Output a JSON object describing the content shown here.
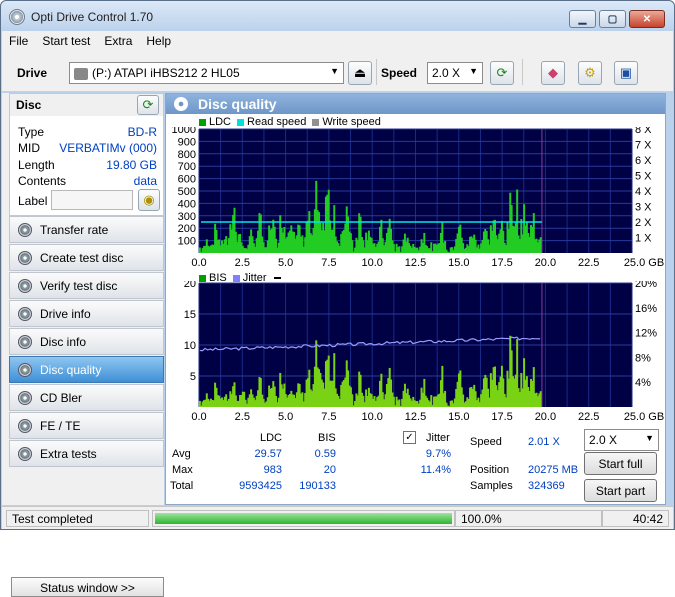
{
  "window": {
    "title": "Opti Drive Control 1.70",
    "min": "▁",
    "max": "▢",
    "close": "✕"
  },
  "menu": [
    "File",
    "Start test",
    "Extra",
    "Help"
  ],
  "toolbar": {
    "drive_label": "Drive",
    "drive_value": "(P:)   ATAPI iHBS212   2 HL05",
    "speed_label": "Speed",
    "speed_value": "2.0 X"
  },
  "disc": {
    "header": "Disc",
    "rows": [
      {
        "key": "Type",
        "value": "BD-R"
      },
      {
        "key": "MID",
        "value": "VERBATIMv (000)"
      },
      {
        "key": "Length",
        "value": "19.80 GB"
      },
      {
        "key": "Contents",
        "value": "data"
      }
    ],
    "label_key": "Label",
    "label_value": ""
  },
  "nav": [
    {
      "label": "Transfer rate",
      "active": false
    },
    {
      "label": "Create test disc",
      "active": false
    },
    {
      "label": "Verify test disc",
      "active": false
    },
    {
      "label": "Drive info",
      "active": false
    },
    {
      "label": "Disc info",
      "active": false
    },
    {
      "label": "Disc quality",
      "active": true
    },
    {
      "label": "CD Bler",
      "active": false
    },
    {
      "label": "FE / TE",
      "active": false
    },
    {
      "label": "Extra tests",
      "active": false
    }
  ],
  "status_window_btn": "Status window >>",
  "panel_title": "Disc quality",
  "chart_data": [
    {
      "type": "bar",
      "legend": [
        {
          "name": "LDC",
          "color": "#00a000"
        },
        {
          "name": "Read speed",
          "color": "#00e0e0"
        },
        {
          "name": "Write speed",
          "color": "#909090"
        }
      ],
      "xlim": [
        0,
        25
      ],
      "ylim": [
        0,
        1000
      ],
      "x_ticks": [
        "0.0",
        "2.5",
        "5.0",
        "7.5",
        "10.0",
        "12.5",
        "15.0",
        "17.5",
        "20.0",
        "22.5",
        "25.0 GB"
      ],
      "y_ticks": [
        "100",
        "200",
        "300",
        "400",
        "500",
        "600",
        "700",
        "800",
        "900",
        "1000"
      ],
      "y2_ticks": [
        "1 X",
        "2 X",
        "3 X",
        "4 X",
        "5 X",
        "6 X",
        "7 X",
        "8 X"
      ],
      "data_end_gb": 19.8,
      "read_speed_x": 2.0,
      "series_ldc_peaks": [
        [
          0.5,
          150
        ],
        [
          1.0,
          300
        ],
        [
          1.5,
          200
        ],
        [
          2.0,
          550
        ],
        [
          2.3,
          250
        ],
        [
          3.0,
          200
        ],
        [
          3.5,
          400
        ],
        [
          4.2,
          450
        ],
        [
          4.8,
          500
        ],
        [
          5.3,
          600
        ],
        [
          5.8,
          300
        ],
        [
          6.3,
          450
        ],
        [
          6.8,
          650
        ],
        [
          7.0,
          250
        ],
        [
          7.4,
          800
        ],
        [
          7.8,
          400
        ],
        [
          8.3,
          300
        ],
        [
          8.6,
          500
        ],
        [
          9.3,
          450
        ],
        [
          9.8,
          350
        ],
        [
          10.5,
          300
        ],
        [
          11.0,
          350
        ],
        [
          12.0,
          250
        ],
        [
          13.0,
          250
        ],
        [
          14.0,
          300
        ],
        [
          15.0,
          350
        ],
        [
          15.8,
          250
        ],
        [
          16.5,
          300
        ],
        [
          17.0,
          450
        ],
        [
          17.5,
          350
        ],
        [
          18.0,
          550
        ],
        [
          18.3,
          700
        ],
        [
          18.8,
          600
        ],
        [
          19.3,
          450
        ],
        [
          19.7,
          150
        ]
      ]
    },
    {
      "type": "bar",
      "legend": [
        {
          "name": "BIS",
          "color": "#00a000"
        },
        {
          "name": "Jitter",
          "color": "#8080ff"
        }
      ],
      "xlim": [
        0,
        25
      ],
      "ylim": [
        0,
        20
      ],
      "x_ticks": [
        "0.0",
        "2.5",
        "5.0",
        "7.5",
        "10.0",
        "12.5",
        "15.0",
        "17.5",
        "20.0",
        "22.5",
        "25.0 GB"
      ],
      "y_ticks": [
        "5",
        "10",
        "15",
        "20"
      ],
      "y2_ticks": [
        "4%",
        "8%",
        "12%",
        "16%",
        "20%"
      ],
      "data_end_gb": 19.8,
      "series_bis_peaks": [
        [
          0.5,
          3
        ],
        [
          1.0,
          5
        ],
        [
          1.5,
          3
        ],
        [
          2.0,
          6
        ],
        [
          2.5,
          4
        ],
        [
          3.0,
          3
        ],
        [
          3.5,
          6
        ],
        [
          4.2,
          7
        ],
        [
          4.8,
          9
        ],
        [
          5.3,
          7
        ],
        [
          5.8,
          5
        ],
        [
          6.3,
          8
        ],
        [
          6.8,
          12
        ],
        [
          7.0,
          6
        ],
        [
          7.4,
          13
        ],
        [
          7.8,
          9
        ],
        [
          8.3,
          7
        ],
        [
          8.6,
          10
        ],
        [
          9.3,
          8
        ],
        [
          9.8,
          6
        ],
        [
          10.5,
          6
        ],
        [
          11.0,
          8
        ],
        [
          12.0,
          6
        ],
        [
          13.0,
          7
        ],
        [
          14.0,
          8
        ],
        [
          15.0,
          9
        ],
        [
          15.8,
          6
        ],
        [
          16.5,
          8
        ],
        [
          17.0,
          11
        ],
        [
          17.5,
          9
        ],
        [
          18.0,
          13
        ],
        [
          18.3,
          15
        ],
        [
          18.8,
          12
        ],
        [
          19.3,
          9
        ],
        [
          19.7,
          3
        ]
      ],
      "jitter_pct_start": 9.2,
      "jitter_pct_end": 11.2
    }
  ],
  "stats": {
    "col_ldc": "LDC",
    "col_bis": "BIS",
    "jitter_label": "Jitter",
    "jitter_checked": true,
    "rows": [
      {
        "label": "Avg",
        "ldc": "29.57",
        "bis": "0.59",
        "jitter": "9.7%"
      },
      {
        "label": "Max",
        "ldc": "983",
        "bis": "20",
        "jitter": "11.4%"
      },
      {
        "label": "Total",
        "ldc": "9593425",
        "bis": "190133",
        "jitter": ""
      }
    ],
    "speed_label": "Speed",
    "speed_value": "2.01 X",
    "position_label": "Position",
    "position_value": "20275 MB",
    "samples_label": "Samples",
    "samples_value": "324369",
    "speed_select": "2.0 X",
    "start_full": "Start full",
    "start_part": "Start part"
  },
  "statusbar": {
    "text": "Test completed",
    "progress_pct": 100,
    "progress_text": "100.0%",
    "time": "40:42"
  }
}
